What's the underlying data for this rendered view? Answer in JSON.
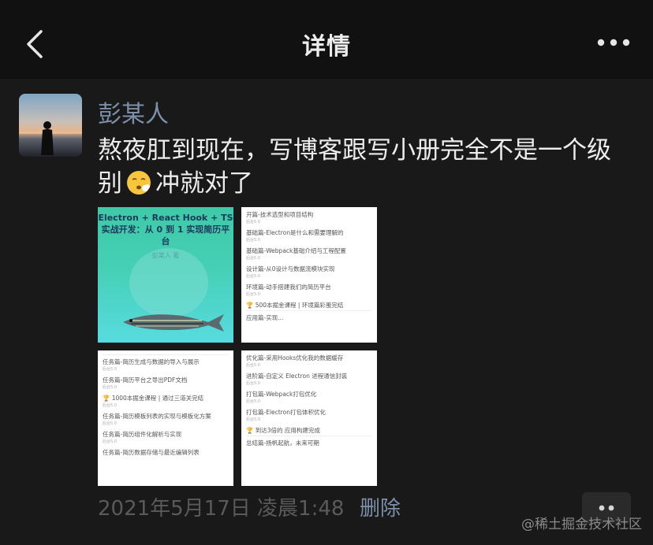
{
  "header": {
    "back_icon": "chevron-left-icon",
    "title": "详情",
    "more_icon": "more-dots-icon"
  },
  "post": {
    "author": "彭某人",
    "text_before_emoji": "熬夜肛到现在，写博客跟写小册完全不是一个级别",
    "emoji": "exhausted-face-emoji",
    "text_after_emoji": "冲就对了",
    "images": {
      "cover": {
        "title": "Electron + React Hook + TS 实战开发：从 0 到 1 实现简历平台",
        "author": "彭某人 著"
      },
      "toc_a": [
        "开篇-技术选型和项目结构",
        "基础篇-Electron是什么和需要理解的",
        "基础篇-Webpack基础介绍与工程配置",
        "设计篇-从0设计与数据流模块实现",
        "环境篇-动手搭建我们的简历平台",
        "🏆 500本掘金课程 | 环境篇彩蛋完结",
        "应用篇-实现..."
      ],
      "toc_b": [
        "任务篇-简历生成与数据的导入与展示",
        "任务篇-简历平台之导出PDF文档",
        "🏆 1000本掘金课程 | 通过三道关完结",
        "任务篇-简历模板列表的实现与模板化方案",
        "任务篇-简历组件化解析与实现",
        "任务篇-简历数据存储与最近编辑列表"
      ],
      "toc_c": [
        "优化篇-采用Hooks优化我的数据缓存",
        "进阶篇-自定义 Electron 进程通信封装",
        "打包篇-Webpack打包优化",
        "打包篇-Electron打包体积优化",
        "🏆 到达3倍的 应用构建完成",
        "总结篇-扬帆起航，未来可期"
      ],
      "toc_sub": "后台5.0"
    }
  },
  "footer": {
    "date": "2021年5月17日 凌晨1:48",
    "delete_label": "删除",
    "comment_icon": "comment-dots-icon"
  },
  "watermark": "@稀土掘金技术社区"
}
